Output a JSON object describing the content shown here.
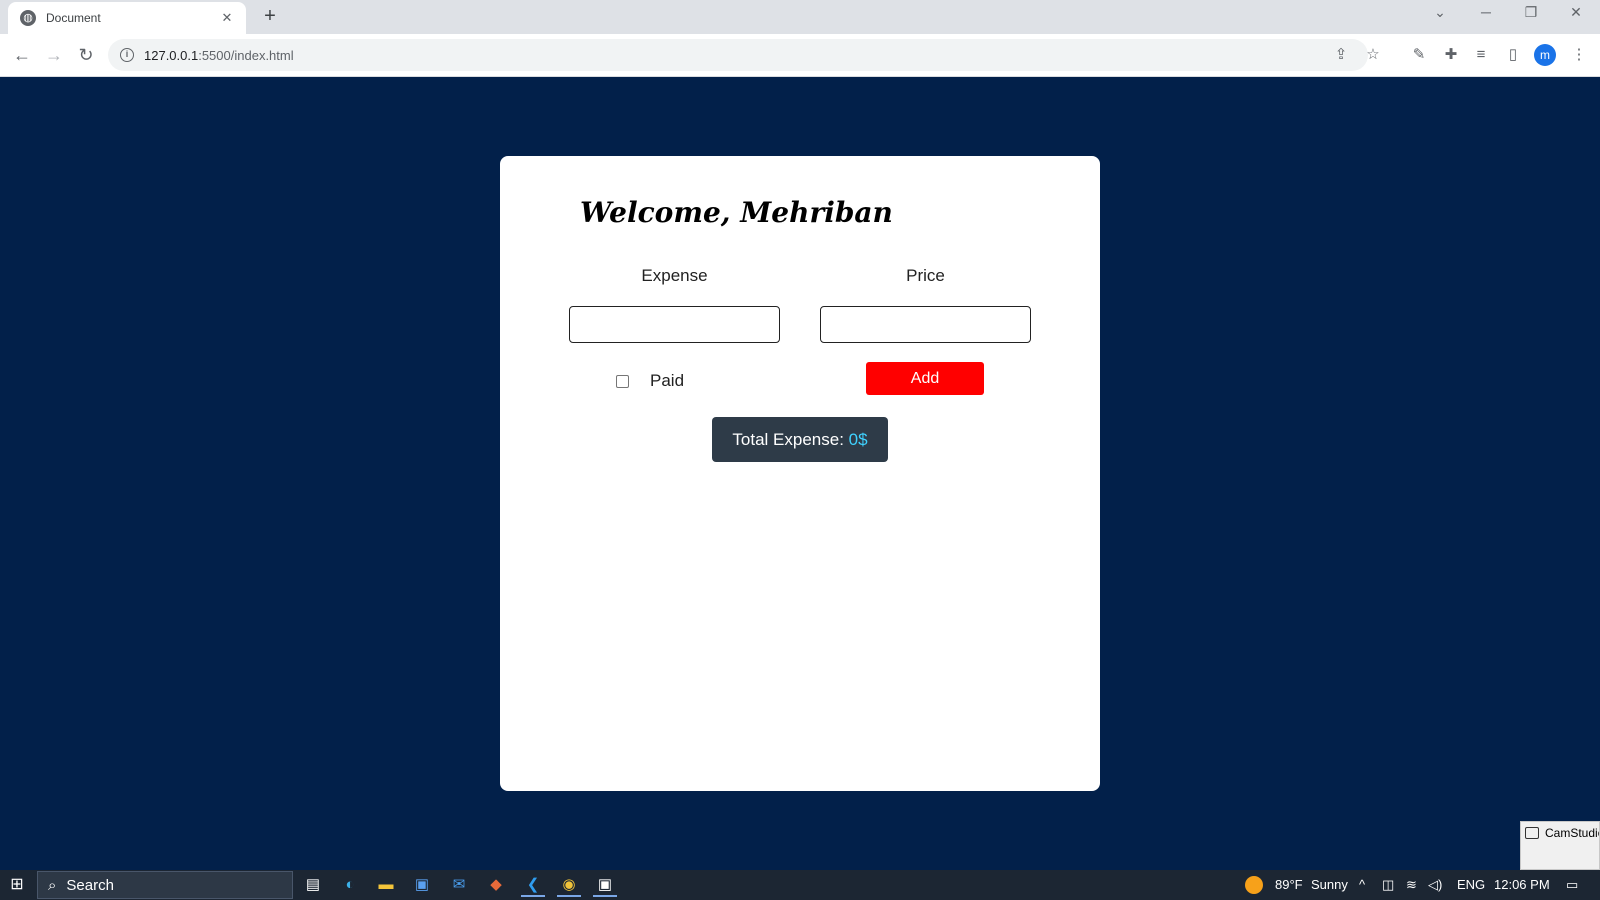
{
  "browser": {
    "tab_title": "Document",
    "tab_close": "✕",
    "new_tab": "+",
    "url_host": "127.0.0.1",
    "url_path": ":5500/index.html",
    "profile_initial": "m"
  },
  "page": {
    "welcome": "Welcome, Mehriban",
    "expense_label": "Expense",
    "price_label": "Price",
    "expense_value": "",
    "price_value": "",
    "paid_label": "Paid",
    "paid_checked": false,
    "add_label": "Add",
    "total_prefix": "Total Expense: ",
    "total_amount": "0$"
  },
  "camstudio": {
    "title": "CamStudio"
  },
  "taskbar": {
    "search_label": "Search",
    "weather_temp": "89°F",
    "weather_desc": "Sunny",
    "language": "ENG",
    "time": "12:06 PM"
  },
  "colors": {
    "page_background": "#02204a",
    "add_button": "#ff0000",
    "total_box": "#2e3b48",
    "total_amount": "#3fd2ff"
  }
}
